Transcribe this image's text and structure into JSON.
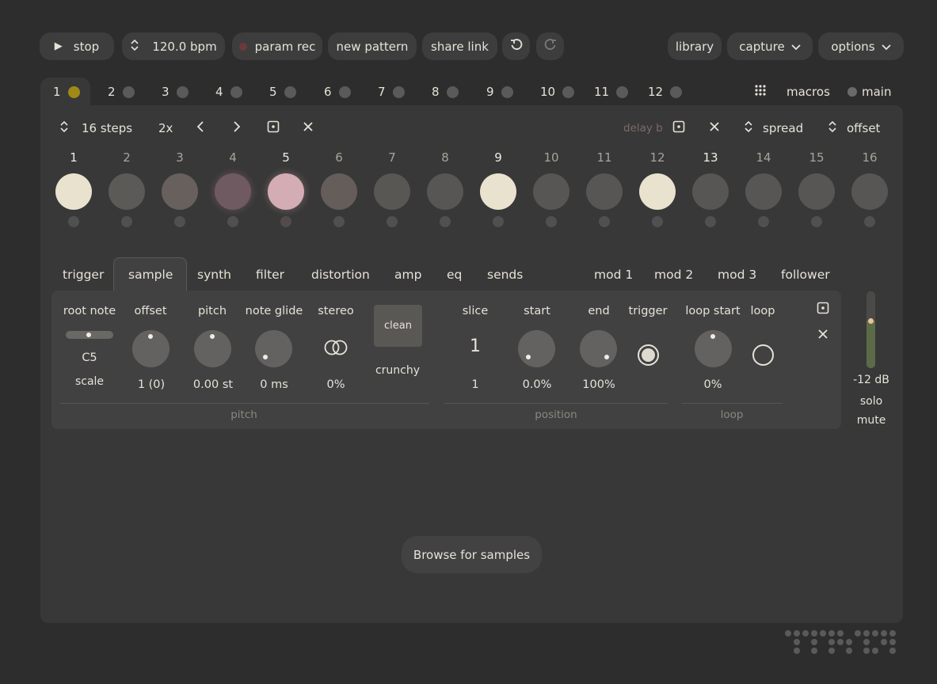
{
  "toolbar": {
    "play_label": "stop",
    "bpm_label": "120.0 bpm",
    "param_rec_label": "param rec",
    "new_pattern_label": "new pattern",
    "share_link_label": "share link",
    "library_label": "library",
    "capture_label": "capture",
    "options_label": "options"
  },
  "tracks": [
    "1",
    "2",
    "3",
    "4",
    "5",
    "6",
    "7",
    "8",
    "9",
    "10",
    "11",
    "12"
  ],
  "track_right": {
    "macros_label": "macros",
    "main_label": "main"
  },
  "pattern_bar": {
    "steps_label": "16 steps",
    "rate_label": "2x",
    "delay_label": "delay b",
    "spread_label": "spread",
    "offset_label": "offset"
  },
  "steps": {
    "numbers": [
      "1",
      "2",
      "3",
      "4",
      "5",
      "6",
      "7",
      "8",
      "9",
      "10",
      "11",
      "12",
      "13",
      "14",
      "15",
      "16"
    ],
    "active_fill": "#e8e2cf",
    "pink_fill": "#d3adb3"
  },
  "param_tabs": [
    "trigger",
    "sample",
    "synth",
    "filter",
    "distortion",
    "amp",
    "eq",
    "sends",
    "mod 1",
    "mod 2",
    "mod 3",
    "follower"
  ],
  "sample": {
    "root_note_label": "root note",
    "root_note_value": "C5",
    "scale_label": "scale",
    "offset_label": "offset",
    "offset_value": "1 (0)",
    "pitch_label": "pitch",
    "pitch_value": "0.00 st",
    "note_glide_label": "note glide",
    "note_glide_value": "0 ms",
    "stereo_label": "stereo",
    "stereo_value": "0%",
    "clean_label": "clean",
    "crunchy_label": "crunchy",
    "pitch_group": "pitch",
    "slice_label": "slice",
    "slice_display": "1",
    "slice_value": "1",
    "start_label": "start",
    "start_value": "0.0%",
    "end_label": "end",
    "end_value": "100%",
    "trigger_label": "trigger",
    "loop_start_label": "loop start",
    "loop_start_value": "0%",
    "loop_label": "loop",
    "position_group": "position",
    "loop_group": "loop"
  },
  "mixer": {
    "level": "-12 dB",
    "solo_label": "solo",
    "mute_label": "mute"
  },
  "browse_label": "Browse for samples",
  "colors": {
    "accent_dot": "#a08a16",
    "rec_dot": "#6b3a3a"
  }
}
